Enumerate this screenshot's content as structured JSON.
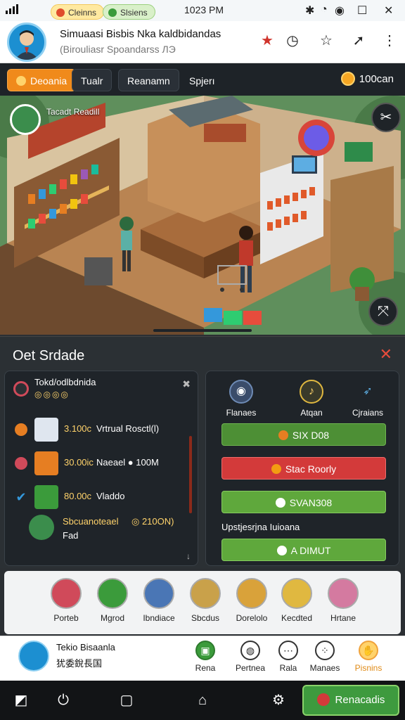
{
  "status_bar": {
    "chip1": "Cleinns",
    "chip2": "Slsiens",
    "time": "1023 PM"
  },
  "header": {
    "title": "Simuaasi Bisbis Nka kaldbidandas",
    "subtitle": "(Birouliasr Spoandarss ЛЭ"
  },
  "tabs": [
    {
      "label": "Deoania",
      "active": true
    },
    {
      "label": "Tualr",
      "active": false
    },
    {
      "label": "Reanamn",
      "active": false
    },
    {
      "label": "Spjerı",
      "active": false
    }
  ],
  "coins": "100can",
  "scene": {
    "room_label": "Tacadt Readill"
  },
  "store": {
    "title": "Oet Srdade",
    "owner_name": "Tokd/odlbdnida",
    "owner_badges": "◎◎◎◎",
    "sales": [
      {
        "price": "3.100c",
        "label": "Vrtrual Rosctl(l)",
        "mark": "orange"
      },
      {
        "price": "30.00ic",
        "label": "Naeael ● 100M",
        "mark": "red"
      },
      {
        "price": "80.00c",
        "label": "Vladdo",
        "mark": "check"
      }
    ],
    "pack": {
      "name": "Sbcuanoteael",
      "price": "◎ 210ON)",
      "sub": "Fad"
    },
    "options": [
      {
        "label": "Flanaes"
      },
      {
        "label": "Atqan"
      },
      {
        "label": "Cjraians"
      }
    ],
    "buttons": {
      "buy": "SIX D08",
      "sell": "Stac Roorly",
      "stock": "SVAN308",
      "upgrade": "A DIMUT"
    },
    "upgrade_label": "Upstjesrjna Iuioana"
  },
  "categories": [
    {
      "label": "Porteb",
      "color": "#d04a5a"
    },
    {
      "label": "Mgrod",
      "color": "#3b9b3b"
    },
    {
      "label": "Ibndiace",
      "color": "#4a76b5"
    },
    {
      "label": "Sbcdus",
      "color": "#c9a14a"
    },
    {
      "label": "Dorelolo",
      "color": "#d9a23a"
    },
    {
      "label": "Kecdted",
      "color": "#e0b840"
    },
    {
      "label": "Hrtane",
      "color": "#d47aa0"
    }
  ],
  "profile": {
    "name": "Tekio Bisaanla",
    "sub": "犹委銳長国"
  },
  "nav": [
    {
      "label": "Rena",
      "icon": "shop-icon"
    },
    {
      "label": "Pertnea",
      "icon": "globe-icon"
    },
    {
      "label": "Rala",
      "icon": "chat-icon"
    },
    {
      "label": "Manaes",
      "icon": "settings-icon"
    },
    {
      "label": "Pisnins",
      "icon": "hand-icon",
      "active": true
    }
  ],
  "rewards_button": "Renacadis",
  "colors": {
    "accent_orange": "#f08a1b",
    "panel_bg": "#2b3034",
    "green": "#4d8f35",
    "red": "#d33a3a"
  }
}
